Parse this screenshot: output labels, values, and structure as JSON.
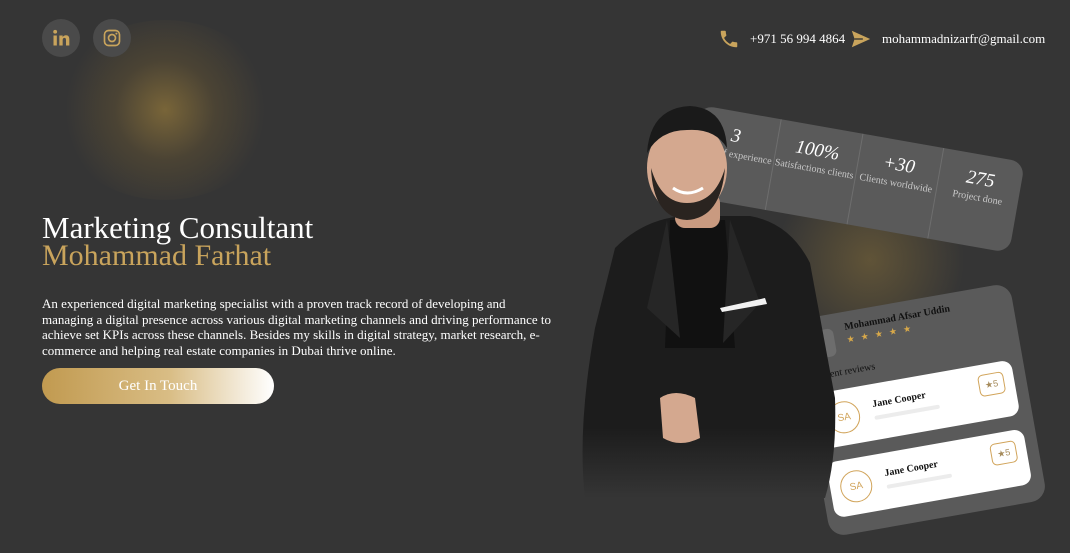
{
  "social": {
    "linkedin_icon": "linkedin-icon",
    "instagram_icon": "instagram-icon"
  },
  "contact": {
    "phone": "+971 56 994 4864",
    "phone_icon": "phone-icon",
    "email": "mohammadnizarfr@gmail.com",
    "email_icon": "send-icon"
  },
  "hero": {
    "role": "Marketing Consultant",
    "name": "Mohammad Farhat",
    "description": "An experienced digital marketing specialist with a proven track record of developing and managing a digital presence across various digital marketing channels and driving performance to achieve set KPIs across these channels. Besides my skills in digital strategy, market research, e-commerce and helping real estate companies in Dubai thrive online.",
    "cta_label": "Get In Touch"
  },
  "stats": [
    {
      "value": "3",
      "label": "Years of experience"
    },
    {
      "value": "100%",
      "label": "Satisfactions clients"
    },
    {
      "value": "+30",
      "label": "Clients worldwide"
    },
    {
      "value": "275",
      "label": "Project done"
    }
  ],
  "reviews": {
    "reviewer": "Mohammad Afsar Uddin",
    "stars": "★ ★ ★ ★ ★",
    "section_label": "Recent reviews",
    "items": [
      {
        "initials": "SA",
        "name": "Jane Cooper",
        "rating": "5"
      },
      {
        "initials": "SA",
        "name": "Jane Cooper",
        "rating": "5"
      }
    ]
  },
  "colors": {
    "background": "#353535",
    "accent_gold": "#c9a45c",
    "card": "#5a5a5a"
  }
}
